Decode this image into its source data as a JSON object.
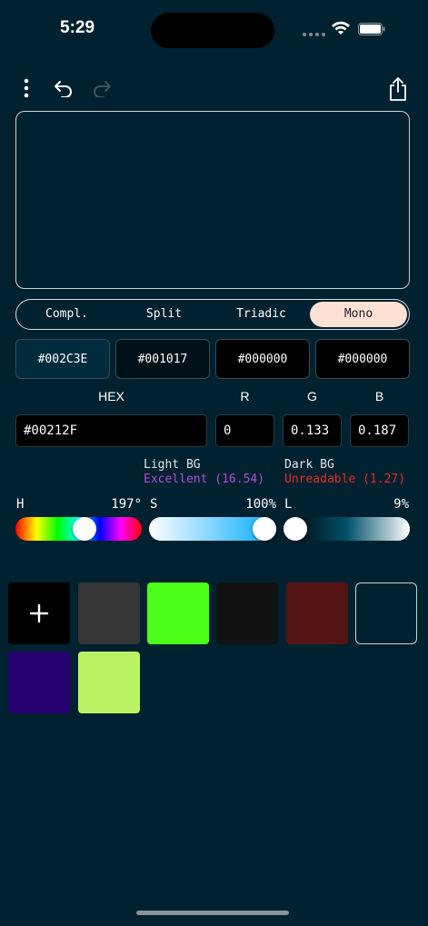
{
  "status": {
    "time": "5:29"
  },
  "toolbar": {
    "menu_icon": "vertical-dots-icon",
    "undo_icon": "undo-icon",
    "redo_icon": "redo-icon",
    "share_icon": "share-icon"
  },
  "harmony_tabs": [
    {
      "label": "Compl.",
      "active": false
    },
    {
      "label": "Split",
      "active": false
    },
    {
      "label": "Triadic",
      "active": false
    },
    {
      "label": "Mono",
      "active": true
    }
  ],
  "harmony_swatches": [
    {
      "hex": "#002C3E",
      "color": "#002C3E"
    },
    {
      "hex": "#001017",
      "color": "#001017"
    },
    {
      "hex": "#000000",
      "color": "#000000"
    },
    {
      "hex": "#000000",
      "color": "#000000"
    }
  ],
  "inputs": {
    "hex_label": "HEX",
    "r_label": "R",
    "g_label": "G",
    "b_label": "B",
    "hex_value": "#00212F",
    "r_value": "0",
    "g_value": "0.133",
    "b_value": "0.187"
  },
  "contrast": {
    "light_label": "Light BG",
    "light_value": "Excellent (16.54)",
    "dark_label": "Dark BG",
    "dark_value": "Unreadable (1.27)"
  },
  "sliders": {
    "h_label": "H",
    "h_value": "197°",
    "h_fraction": 0.547,
    "s_label": "S",
    "s_value": "100%",
    "s_fraction": 1.0,
    "l_label": "L",
    "l_value": "9%",
    "l_fraction": 0.09
  },
  "saved_colors": [
    {
      "type": "add",
      "icon": "plus-icon",
      "color": "#000000"
    },
    {
      "color": "#363636"
    },
    {
      "color": "#4CFF19"
    },
    {
      "color": "#121212"
    },
    {
      "color": "#541414"
    },
    {
      "color": "#00212F",
      "selected": true
    },
    {
      "color": "#26006E"
    },
    {
      "color": "#BBF263"
    }
  ],
  "colors": {
    "background": "#00212F",
    "active_tab": "#FFE0D4"
  }
}
